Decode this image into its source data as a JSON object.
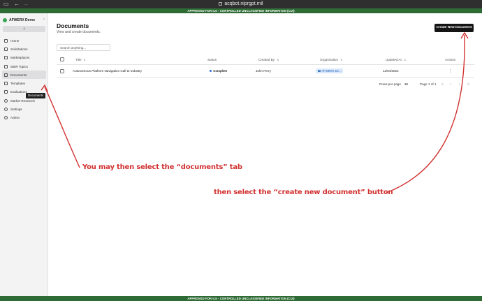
{
  "browser": {
    "url": "acqbot.niprgpt.mil",
    "sidebar_toggle_icon": "sidebar-icon",
    "back_icon": "arrow-left-icon",
    "forward_icon": "arrow-right-icon"
  },
  "banners": {
    "top": "APPROVED FOR IL5 - CONTROLLED UNCLASSIFIED INFORMATION (CUI)",
    "bottom": "APPROVED FOR IL5 - CONTROLLED UNCLASSIFIED INFORMATION (CUI)",
    "color": "#2e6b35"
  },
  "sidebar": {
    "org_name": "AFWERX Demo",
    "collapse_label": "‹",
    "items": [
      {
        "label": "Home",
        "icon": "home-icon"
      },
      {
        "label": "Solicitations",
        "icon": "file-icon"
      },
      {
        "label": "Marketplaces",
        "icon": "store-icon"
      },
      {
        "label": "SBIR Topics",
        "icon": "list-icon"
      },
      {
        "label": "Documents",
        "icon": "document-icon",
        "active": true
      },
      {
        "label": "Templates",
        "icon": "template-icon"
      },
      {
        "label": "Evaluations",
        "icon": "clipboard-icon"
      },
      {
        "label": "Market Research",
        "icon": "search-icon"
      },
      {
        "label": "Settings",
        "icon": "gear-icon"
      },
      {
        "label": "Admin",
        "icon": "user-icon"
      }
    ],
    "tooltip": "Documents"
  },
  "main": {
    "title": "Documents",
    "subtitle": "View and create documents.",
    "create_button": "Create New Document",
    "search_placeholder": "Search anything..."
  },
  "table": {
    "columns": [
      "Title",
      "Status",
      "Created By",
      "Organization",
      "Updated At",
      "Actions"
    ],
    "rows": [
      {
        "title": "Autonomous Platform Navigation Call to Industry",
        "status": "Complete",
        "created_by": "John Ferry",
        "organization": "AFWERX De...",
        "updated_at": "11/04/2024",
        "actions": "⋮"
      }
    ],
    "status_color": "#2f6fe0"
  },
  "pagination": {
    "rows_per_page_label": "Rows per page",
    "rows_per_page_value": "30",
    "page_label": "Page 1 of 1",
    "first": "«",
    "prev": "‹",
    "next": "›",
    "last": "»"
  },
  "annotations": {
    "documents_tab": "You may then select the “documents” tab",
    "create_button": "then select the “create new document” button",
    "color": "#d13130"
  }
}
